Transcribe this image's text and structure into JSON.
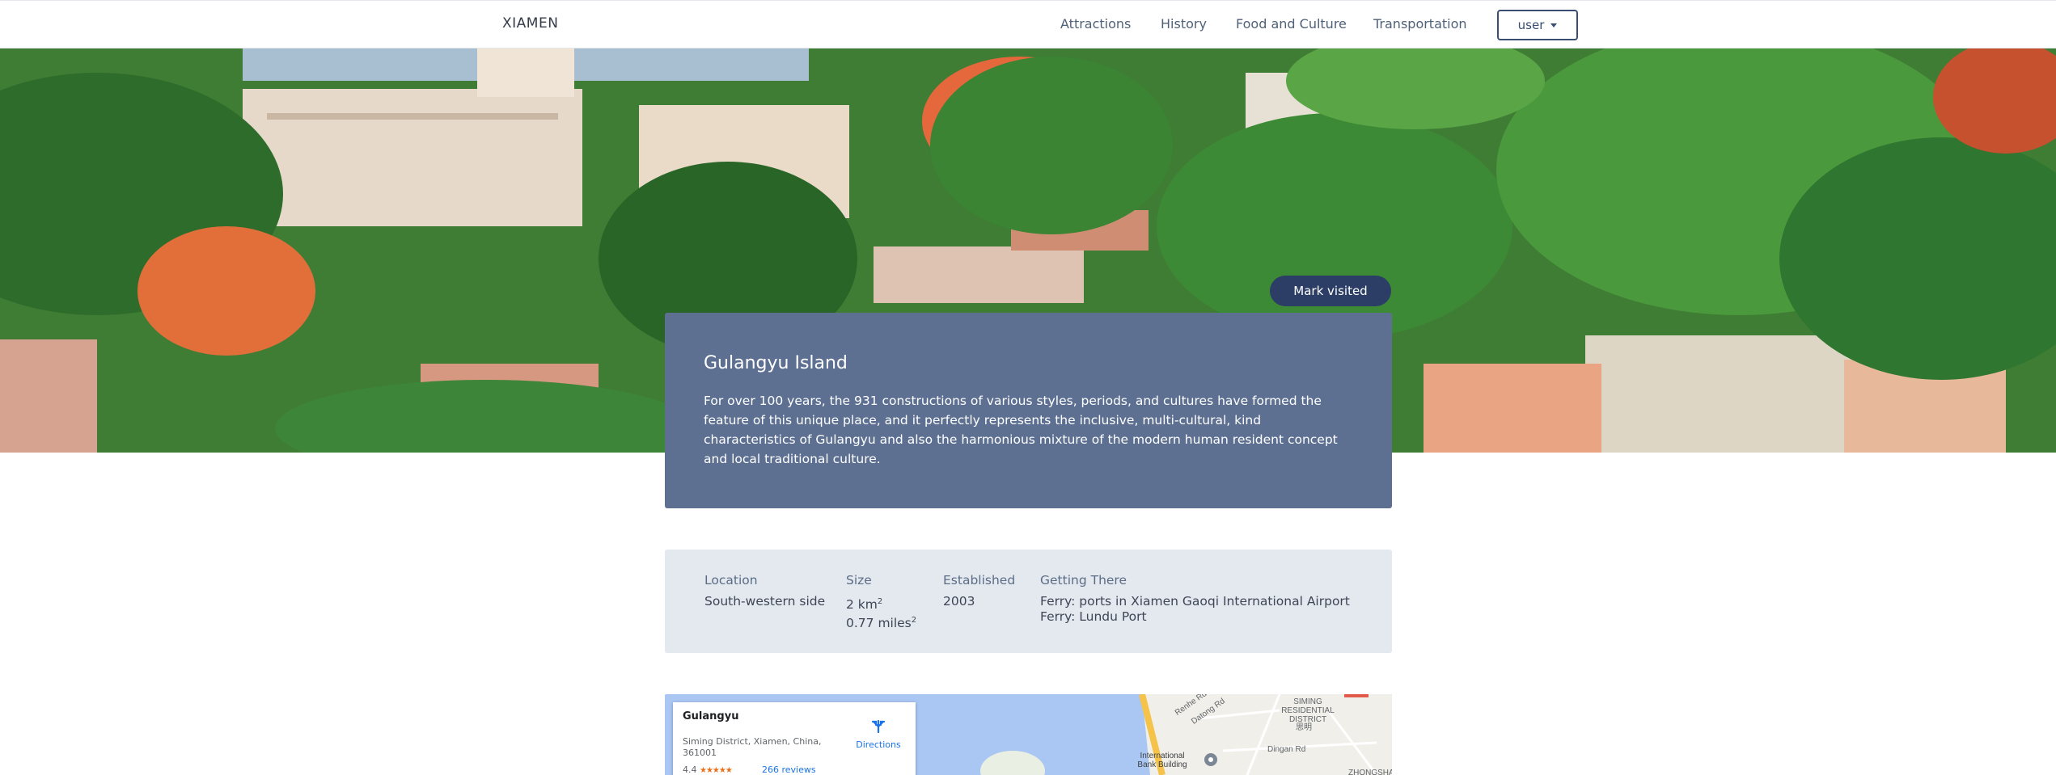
{
  "navbar": {
    "brand": "XIAMEN",
    "links": [
      "Attractions",
      "History",
      "Food and Culture",
      "Transportation"
    ],
    "user_label": "user"
  },
  "hero": {
    "mark_visited_label": "Mark visited"
  },
  "attraction": {
    "title": "Gulangyu Island",
    "description": "For over 100 years, the 931 constructions of various styles, periods, and cultures have formed the feature of this unique place, and it perfectly represents the inclusive, multi-cultural, kind characteristics of Gulangyu and also the harmonious mixture of the modern human resident concept and local traditional culture."
  },
  "details": {
    "location": {
      "label": "Location",
      "value": "South-western side"
    },
    "size": {
      "label": "Size",
      "km": "2 km",
      "miles": "0.77 miles",
      "exp": "2"
    },
    "established": {
      "label": "Established",
      "value": "2003"
    },
    "getting_there": {
      "label": "Getting There",
      "line1": "Ferry: ports in Xiamen Gaoqi International Airport",
      "line2": "Ferry: Lundu Port"
    }
  },
  "map": {
    "place_name": "Gulangyu",
    "address": "Siming District, Xiamen, China, 361001",
    "rating": "4.4",
    "stars": "★★★★★",
    "reviews": "266 reviews",
    "directions_label": "Directions",
    "labels": {
      "siming": "SIMING RESIDENTIAL DISTRICT",
      "siming_cn": "思明",
      "dingan": "Dingan Rd",
      "bank": "International Bank Building",
      "renhe": "Renhe Rd",
      "datong": "Datong Rd",
      "zhongshan": "ZHONGSHA"
    }
  },
  "colors": {
    "navy": "#2c3e66",
    "card": "#5d7092",
    "panel": "#e4e8ef",
    "water": "#aac7f4"
  }
}
